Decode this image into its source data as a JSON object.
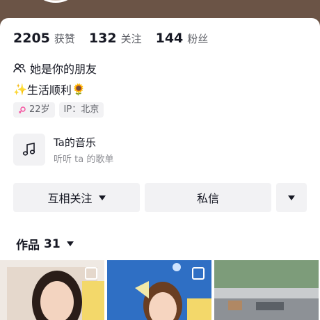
{
  "stats": [
    {
      "num": "2205",
      "label": "获赞"
    },
    {
      "num": "132",
      "label": "关注"
    },
    {
      "num": "144",
      "label": "粉丝"
    }
  ],
  "friend_text": "她是你的朋友",
  "bio": {
    "prefix": "✨",
    "text": "生活顺利",
    "suffix": "🌻"
  },
  "tags": {
    "age": "22岁",
    "ip": "IP：北京"
  },
  "music": {
    "title": "Ta的音乐",
    "subtitle": "听听 ta 的歌单"
  },
  "buttons": {
    "follow": "互相关注",
    "message": "私信"
  },
  "works": {
    "label": "作品",
    "count": "31"
  },
  "colors": {
    "header_bg": "#6b5446",
    "button_bg": "#f2f2f4",
    "text": "#161823",
    "secondary": "#5e6067"
  }
}
